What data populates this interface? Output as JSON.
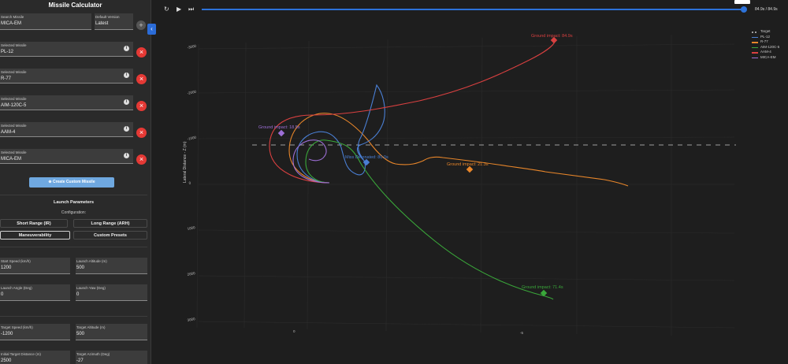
{
  "sidebar": {
    "title": "Missile Calculator",
    "search": {
      "label": "Search Missile",
      "value": "MICA-EM"
    },
    "version": {
      "label": "Default Version",
      "value": "Latest"
    },
    "selected_label": "Selected Missile",
    "selected": [
      "PL-12",
      "R-77",
      "AIM-120C-5",
      "AAM-4",
      "MICA-EM"
    ],
    "create_button": "Create Custom Missile",
    "launch_params_title": "Launch Parameters",
    "configuration_label": "Configuration:",
    "config_options": [
      "Short Range (IR)",
      "Long Range (ARH)",
      "Maneuverability",
      "Custom Presets"
    ],
    "active_config": "Maneuverability",
    "fields": {
      "start_speed": {
        "label": "Start Speed (km/h)",
        "value": "1200"
      },
      "launch_altitude": {
        "label": "Launch Altitude (m)",
        "value": "500"
      },
      "launch_angle": {
        "label": "Launch Angle (Deg)",
        "value": "0"
      },
      "launch_yaw": {
        "label": "Launch Yaw (Deg)",
        "value": "0"
      },
      "target_speed": {
        "label": "Target Speed (km/h)",
        "value": "-1200"
      },
      "target_altitude": {
        "label": "Target Altitude (m)",
        "value": "500"
      },
      "target_distance": {
        "label": "Initial Target Distance (m)",
        "value": "2500"
      },
      "target_azimuth": {
        "label": "Target Azimuth (Deg)",
        "value": "-27"
      }
    }
  },
  "toolbar": {
    "time_readout": "84.9s / 84.9s",
    "progress": 1.0
  },
  "plot": {
    "axis_label": "Lateral Distance - Z (m)",
    "ticks_z": [
      "-3000",
      "-2000",
      "-1000",
      "0",
      "1000",
      "2000",
      "3000"
    ],
    "ticks_bottom": [
      "0",
      "-5"
    ],
    "legend": [
      {
        "name": "Target",
        "color": "#9e9e9e",
        "dashed": true
      },
      {
        "name": "PL-12",
        "color": "#4a7fd4"
      },
      {
        "name": "R-77",
        "color": "#e8862a"
      },
      {
        "name": "AIM-120C-5",
        "color": "#3aa83a"
      },
      {
        "name": "AAM-4",
        "color": "#d94040"
      },
      {
        "name": "MICA-EM",
        "color": "#9d6fd6"
      }
    ],
    "annotations": [
      {
        "text": "Ground impact: 84.9s",
        "color": "#d94040"
      },
      {
        "text": "Ground impact: 18.5s",
        "color": "#9d6fd6"
      },
      {
        "text": "Miss Detonated: 80.0s",
        "color": "#4a7fd4"
      },
      {
        "text": "Ground impact: 21.3s",
        "color": "#e8862a"
      },
      {
        "text": "Ground impact: 71.4s",
        "color": "#3aa83a"
      }
    ]
  }
}
